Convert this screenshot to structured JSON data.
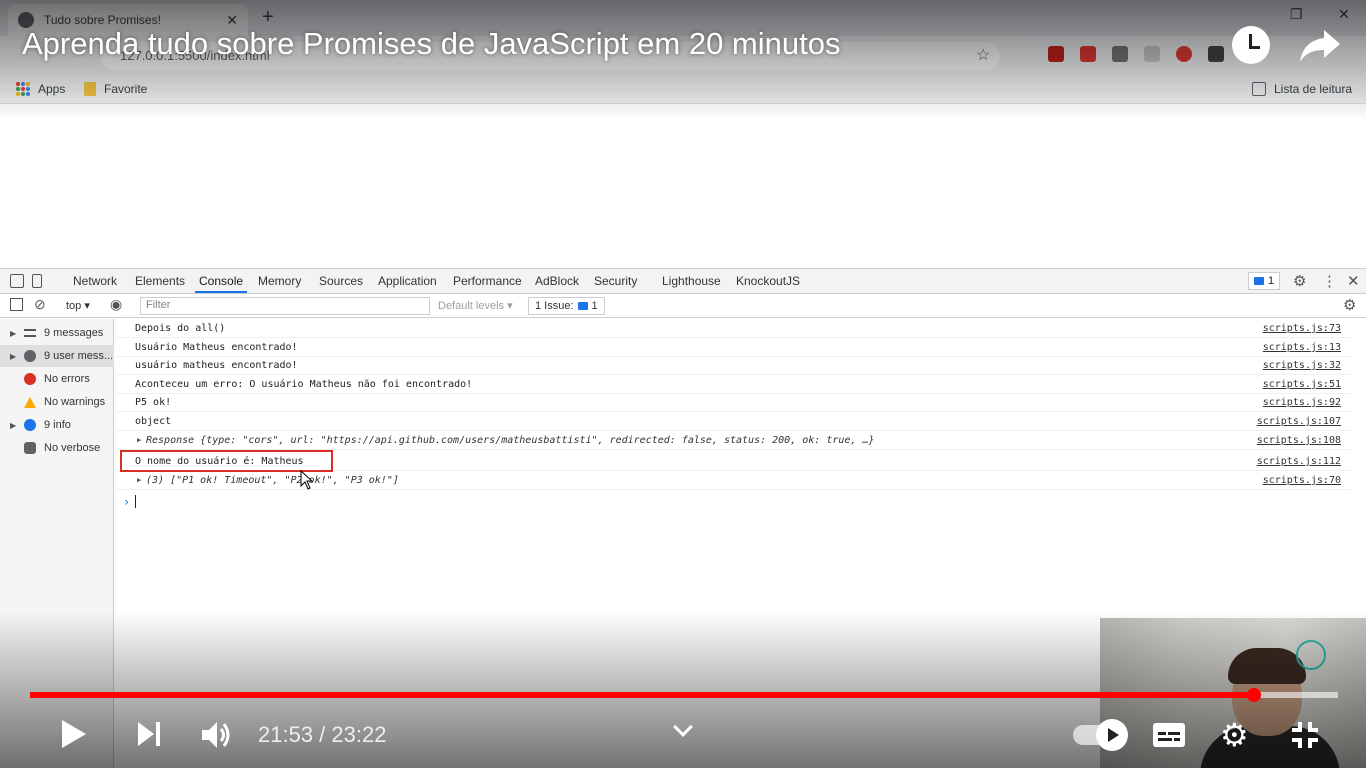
{
  "browser": {
    "tab_title": "Tudo sobre Promises!",
    "url": "127.0.0.1:5500/index.html",
    "bookmarks": [
      {
        "label": "Apps",
        "icon": "apps-grid-icon"
      },
      {
        "label": "Favorite",
        "icon": "folder-icon"
      }
    ],
    "reading_list_label": "Lista de leitura"
  },
  "video": {
    "title": "Aprenda tudo sobre Promises de JavaScript em 20 minutos",
    "current_time": "21:53",
    "duration": "23:22",
    "time_display": "21:53 / 23:22",
    "progress_fraction": 0.936
  },
  "devtools": {
    "tabs": [
      "Network",
      "Elements",
      "Console",
      "Memory",
      "Sources",
      "Application",
      "Performance",
      "AdBlock",
      "Security",
      "Lighthouse",
      "KnockoutJS"
    ],
    "active_tab": "Console",
    "issues_badge": "1",
    "context": "top ▾",
    "filter_placeholder": "Filter",
    "levels": "Default levels ▾",
    "issue_button_label": "1 Issue:",
    "issue_button_count": "1",
    "sidebar": [
      {
        "label": "9 messages",
        "icon": "list-icon"
      },
      {
        "label": "9 user mess...",
        "icon": "user-icon"
      },
      {
        "label": "No errors",
        "icon": "error-icon"
      },
      {
        "label": "No warnings",
        "icon": "warning-icon"
      },
      {
        "label": "9 info",
        "icon": "info-icon"
      },
      {
        "label": "No verbose",
        "icon": "verbose-icon"
      }
    ],
    "console": [
      {
        "text": "Depois do all()",
        "source": "scripts.js:73"
      },
      {
        "text": "Usuário Matheus encontrado!",
        "source": "scripts.js:13"
      },
      {
        "text": "usuário matheus encontrado!",
        "source": "scripts.js:32"
      },
      {
        "text": "Aconteceu um erro: O usuário Matheus não foi encontrado!",
        "source": "scripts.js:51"
      },
      {
        "text": "P5 ok!",
        "source": "scripts.js:92"
      },
      {
        "text": "object",
        "source": "scripts.js:107"
      },
      {
        "text": "Response {type: \"cors\", url: \"https://api.github.com/users/matheusbattisti\", redirected: false, status: 200, ok: true, …}",
        "source": "scripts.js:108"
      },
      {
        "text": "O nome do usuário é: Matheus",
        "source": "scripts.js:112"
      },
      {
        "text": "(3) [\"P1 ok! Timeout\", \"P2 ok!\", \"P3 ok!\"]",
        "source": "scripts.js:70"
      }
    ]
  },
  "colors": {
    "progress_played": "#ff0000",
    "devtools_accent": "#1a73e8",
    "highlight_box": "#d93025"
  }
}
